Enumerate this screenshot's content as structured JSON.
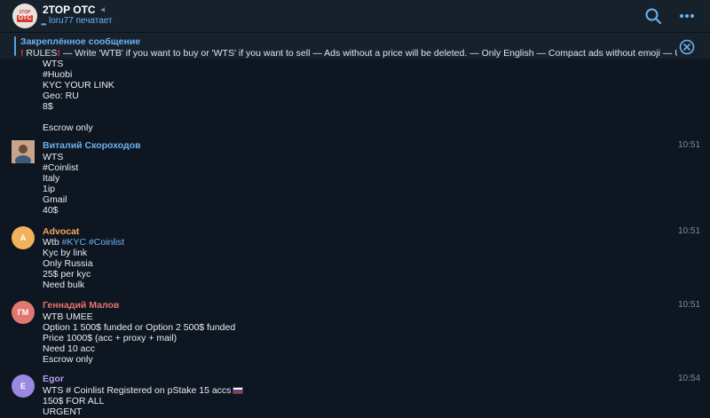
{
  "header": {
    "avatar_top": "2TOP",
    "avatar_bottom": "OTC",
    "title": "2TOP OTC",
    "status": "loru77 печатает",
    "icons": [
      "search-icon",
      "more-icon",
      "muted-icon"
    ]
  },
  "pinned": {
    "label": "Закреплённое сообщение",
    "text_parts": [
      "RULES",
      " — Write 'WTB' if you want to buy or 'WTS' if you want to sell — Ads without a price will be deleted. — Only English — Compact ads without emoji  — U..."
    ],
    "icons": [
      "exclamation-icon",
      "close-icon"
    ]
  },
  "messages": [
    {
      "id": "m0",
      "lines": [
        {
          "text": "WTS"
        },
        {
          "tag": "#Huobi"
        },
        {
          "text": "KYC YOUR LINK"
        },
        {
          "text": "Geo: RU"
        },
        {
          "text": "8$"
        },
        {
          "text": ""
        },
        {
          "text": "Escrow only"
        }
      ]
    },
    {
      "id": "m1",
      "author": "Виталий Скороходов",
      "author_color": "#6ab2f2",
      "time": "10:51",
      "lines": [
        {
          "text": "WTS"
        },
        {
          "tag": "#Coinlist"
        },
        {
          "text": "Italy"
        },
        {
          "text": "1ip"
        },
        {
          "text": "Gmail"
        },
        {
          "text": "40$"
        }
      ]
    },
    {
      "id": "m2",
      "author": "Advocat",
      "author_color": "#f5a65b",
      "avatar_initials": "A",
      "avatar_color": "#f2b25c",
      "time": "10:51",
      "lines": [
        {
          "text": "Wtb ",
          "tags": "#KYC #Coinlist"
        },
        {
          "text": "Kyc by link"
        },
        {
          "text": "Only Russia"
        },
        {
          "text": "25$ per kyc"
        },
        {
          "text": "Need bulk"
        }
      ]
    },
    {
      "id": "m3",
      "author": "Геннадий Малов",
      "author_color": "#e8756a",
      "avatar_initials": "ГМ",
      "avatar_color": "#e0786f",
      "time": "10:51",
      "lines": [
        {
          "text": "WTB UMEE"
        },
        {
          "text": "Option 1 500$ funded or Option 2 500$ funded"
        },
        {
          "text": "Price 1000$ (acc + proxy + mail)"
        },
        {
          "text": "Need 10 acc"
        },
        {
          "text": "Escrow only"
        }
      ]
    },
    {
      "id": "m4",
      "author": "Egor",
      "author_color": "#b69cf0",
      "avatar_initials": "E",
      "avatar_color": "#9a88e3",
      "time": "10:54",
      "lines": [
        {
          "text": "WTS # Coinlist Registered on pStake 15 accs",
          "icon": "russia-flag-icon"
        },
        {
          "text": "150$ FOR ALL"
        },
        {
          "text": "URGENT"
        }
      ]
    }
  ]
}
